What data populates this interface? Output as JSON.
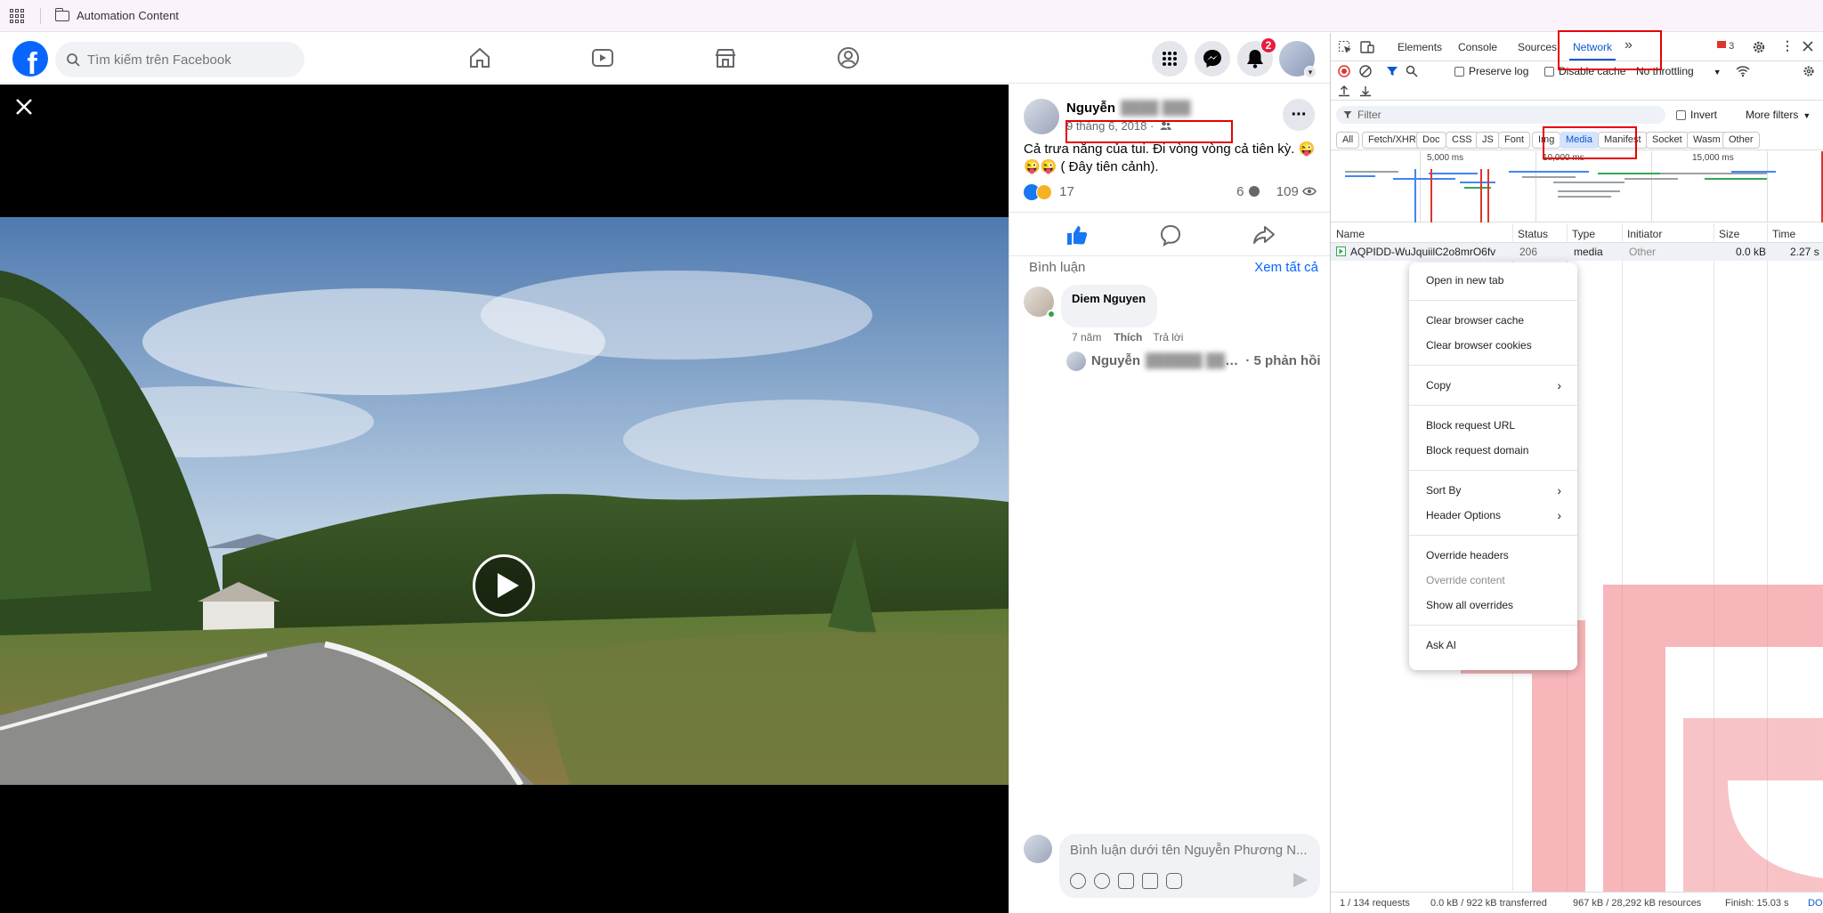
{
  "bookmarks": {
    "folder": "Automation Content"
  },
  "facebook": {
    "search_placeholder": "Tìm kiếm trên Facebook",
    "notif_count": "2",
    "post": {
      "author": "Nguyễn",
      "date": "9 tháng 6, 2018 ·",
      "text": "Cả trưa nắng của tui. Đi vòng vòng cả tiên kỳ. 😜😜😜 ( Đây tiên cảnh).",
      "reactions_count": "17",
      "comments_count": "6",
      "views_count": "109"
    },
    "comments": {
      "heading": "Bình luận",
      "see_all": "Xem tất cả",
      "first_author": "Diem Nguyen",
      "time": "7 năm",
      "like": "Thích",
      "reply": "Trả lời",
      "reply_author": "Nguyễn",
      "reply_ellipsis": "…",
      "reply_count": "· 5 phản hồi"
    },
    "composer_placeholder": "Bình luận dưới tên Nguyễn Phương N..."
  },
  "devtools": {
    "tabs": [
      "Elements",
      "Console",
      "Sources",
      "Network"
    ],
    "errors_count": "3",
    "preserve_log": "Preserve log",
    "disable_cache": "Disable cache",
    "throttling": "No throttling",
    "filter_placeholder": "Filter",
    "invert": "Invert",
    "more_filters": "More filters",
    "types": [
      "All",
      "Fetch/XHR",
      "Doc",
      "CSS",
      "JS",
      "Font",
      "Img",
      "Media",
      "Manifest",
      "Socket",
      "Wasm",
      "Other"
    ],
    "active_type": "Media",
    "timeline_ticks": [
      "5,000 ms",
      "10,000 ms",
      "15,000 ms"
    ],
    "columns": [
      "Name",
      "Status",
      "Type",
      "Initiator",
      "Size",
      "Time"
    ],
    "rows": [
      {
        "name": "AQPIDD-WuJquiilC2o8mrO6fv",
        "status": "206",
        "type": "media",
        "initiator": "Other",
        "size": "0.0 kB",
        "time": "2.27 s"
      }
    ],
    "status_bar": {
      "requests": "1 / 134 requests",
      "transferred": "0.0 kB / 922 kB transferred",
      "resources": "967 kB / 28,292 kB resources",
      "finish": "Finish: 15.03 s",
      "dom": "DO"
    }
  },
  "context_menu": {
    "items": [
      "Open in new tab",
      "Clear browser cache",
      "Clear browser cookies",
      "Copy",
      "Block request URL",
      "Block request domain",
      "Sort By",
      "Header Options",
      "Override headers",
      "Override content",
      "Show all overrides",
      "Ask AI"
    ]
  },
  "colors": {
    "fb_blue": "#0866ff",
    "devtools_blue": "#0b57d0",
    "highlight_red": "#e60000"
  }
}
